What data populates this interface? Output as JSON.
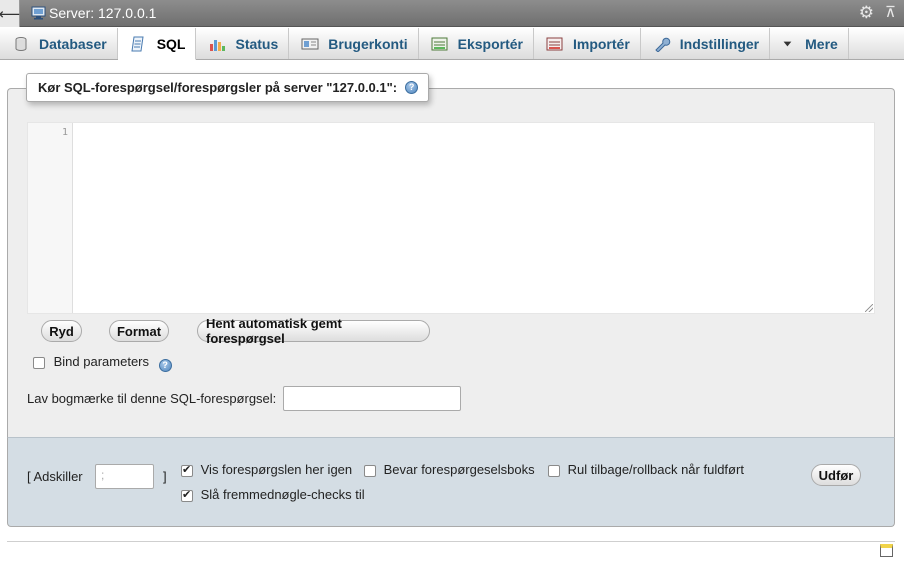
{
  "topbar": {
    "server_label": "Server: 127.0.0.1"
  },
  "tabs": [
    {
      "label": "Databaser",
      "icon": "database-icon"
    },
    {
      "label": "SQL",
      "icon": "sql-icon"
    },
    {
      "label": "Status",
      "icon": "status-chart-icon"
    },
    {
      "label": "Brugerkonti",
      "icon": "user-accounts-icon"
    },
    {
      "label": "Eksportér",
      "icon": "export-icon"
    },
    {
      "label": "Importér",
      "icon": "import-icon"
    },
    {
      "label": "Indstillinger",
      "icon": "wrench-icon"
    },
    {
      "label": "Mere",
      "icon": "caret-down-icon"
    }
  ],
  "sql": {
    "legend": "Kør SQL-forespørgsel/forespørgsler på server \"127.0.0.1\":",
    "line_number": "1",
    "query_text": "",
    "buttons": {
      "clear": "Ryd",
      "format": "Format",
      "autosave": "Hent automatisk gemt forespørgsel"
    },
    "bind_parameters": {
      "label": "Bind parameters",
      "checked": false
    },
    "bookmark": {
      "label": "Lav bogmærke til denne SQL-forespørgsel:",
      "value": ""
    }
  },
  "options": {
    "delimiter_open": "[ Adskiller",
    "delimiter_value": ";",
    "delimiter_close": "]",
    "show_query": {
      "label": "Vis forespørgslen her igen",
      "checked": true
    },
    "retain_box": {
      "label": "Bevar forespørgeselsboks",
      "checked": false
    },
    "rollback": {
      "label": "Rul tilbage/rollback når fuldført",
      "checked": false
    },
    "fk_checks": {
      "label": "Slå fremmednøgle-checks til",
      "checked": true
    },
    "go_button": "Udfør"
  },
  "colors": {
    "tab_text": "#235a81",
    "titlebar": "#7f7f7f",
    "options_bg": "#d4dde4"
  }
}
